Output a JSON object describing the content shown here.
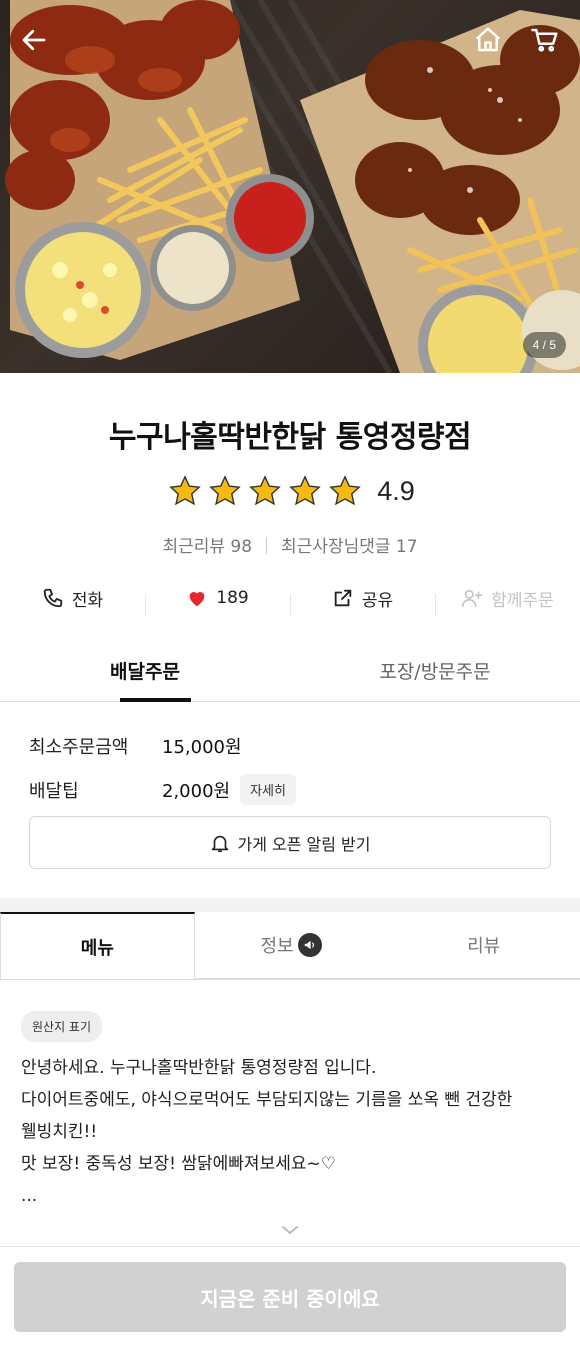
{
  "hero": {
    "counter": "4 / 5",
    "icons": [
      "back-arrow-icon",
      "home-icon",
      "cart-icon"
    ]
  },
  "store": {
    "name": "누구나홀딱반한닭 통영정량점",
    "rating": "4.9",
    "stars": 5,
    "recent_reviews": "최근리뷰 98",
    "owner_replies": "최근사장님댓글 17"
  },
  "actions": {
    "call": "전화",
    "likes": "189",
    "share": "공유",
    "group_order": "함께주문"
  },
  "order_tabs": {
    "delivery": "배달주문",
    "pickup": "포장/방문주문"
  },
  "delivery_info": {
    "min_order_label": "최소주문금액",
    "min_order_value": "15,000원",
    "tip_label": "배달팁",
    "tip_value": "2,000원",
    "detail_button": "자세히",
    "notify_button": "가게 오픈 알림 받기"
  },
  "menu_tabs": {
    "menu": "메뉴",
    "info": "정보",
    "review": "리뷰"
  },
  "intro": {
    "origin_chip": "원산지 표기",
    "lines": [
      "안녕하세요. 누구나홀딱반한닭 통영정량점 입니다.",
      "다이어트중에도, 야식으로먹어도 부담되지않는 기름을 쏘옥 뺀 건강한",
      "웰빙치킨!!",
      "맛 보장! 중독성 보장! 쌈닭에빠져보세요~♡",
      "..."
    ]
  },
  "cta": {
    "label": "지금은 준비 중이에요"
  },
  "colors": {
    "star": "#f5b90f",
    "heart": "#e8262b",
    "cta_disabled": "#d1d1d1"
  }
}
